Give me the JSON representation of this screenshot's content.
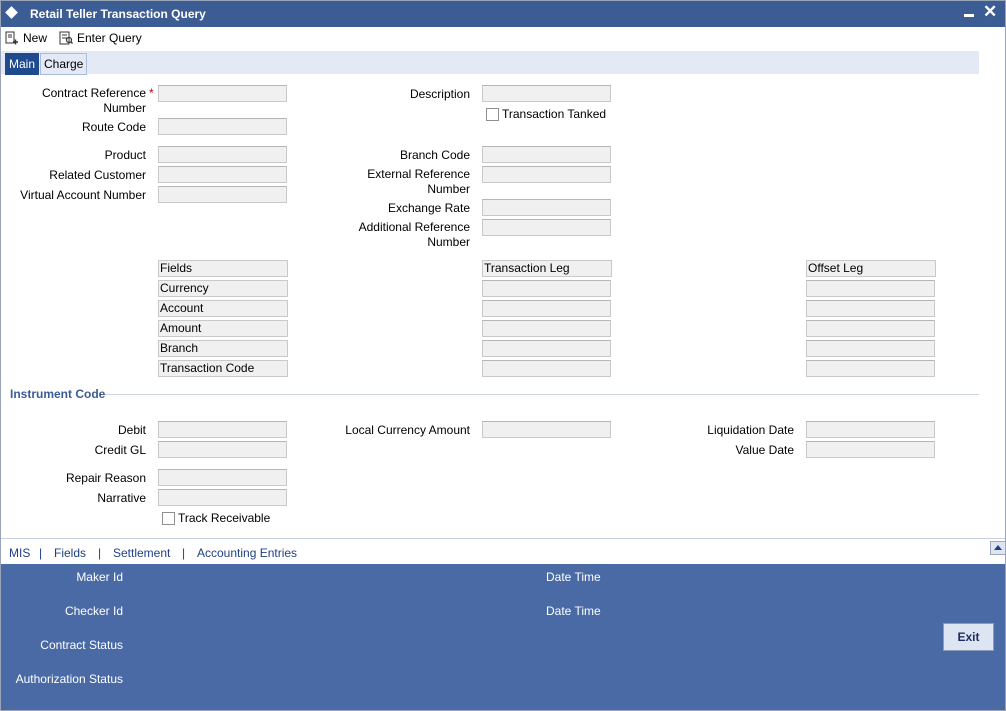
{
  "window": {
    "title": "Retail Teller Transaction Query"
  },
  "toolbar": {
    "new_label": "New",
    "enter_query_label": "Enter Query"
  },
  "tabs": [
    "Main",
    "Charge"
  ],
  "fields": {
    "contract_ref_label": "Contract Reference Number",
    "contract_ref_line1": "Contract Reference",
    "contract_ref_line2": "Number",
    "required_mark": "*",
    "route_code": "Route Code",
    "product": "Product",
    "related_customer": "Related Customer",
    "virtual_account_number": "Virtual Account Number",
    "description": "Description",
    "transaction_tanked": "Transaction Tanked",
    "branch_code": "Branch Code",
    "ext_ref_line1": "External Reference",
    "ext_ref_line2": "Number",
    "exchange_rate": "Exchange Rate",
    "add_ref_line1": "Additional Reference",
    "add_ref_line2": "Number"
  },
  "grid": {
    "headers": [
      "Fields",
      "Transaction Leg",
      "Offset Leg"
    ],
    "rows": [
      "Currency",
      "Account",
      "Amount",
      "Branch",
      "Transaction Code"
    ]
  },
  "instrument": {
    "section_title": "Instrument Code",
    "debit": "Debit",
    "credit_gl": "Credit GL",
    "local_currency_amount": "Local Currency Amount",
    "liquidation_date": "Liquidation Date",
    "value_date": "Value Date",
    "repair_reason": "Repair Reason",
    "narrative": "Narrative",
    "track_receivable": "Track Receivable"
  },
  "sublinks": [
    "MIS",
    "|",
    "Fields",
    "|",
    "Settlement",
    "|",
    "Accounting Entries"
  ],
  "footer": {
    "maker_id": "Maker Id",
    "checker_id": "Checker Id",
    "contract_status": "Contract Status",
    "authorization_status": "Authorization Status",
    "date_time_1": "Date Time",
    "date_time_2": "Date Time",
    "exit_label": "Exit"
  },
  "colors": {
    "titlebar": "#3c5c94",
    "footer": "#4a6aa5",
    "active_tab": "#1f4b8e",
    "required": "#c00000"
  },
  "icons": {
    "new": "new-document-icon",
    "enter_query": "query-icon",
    "window": "diamond-icon"
  }
}
